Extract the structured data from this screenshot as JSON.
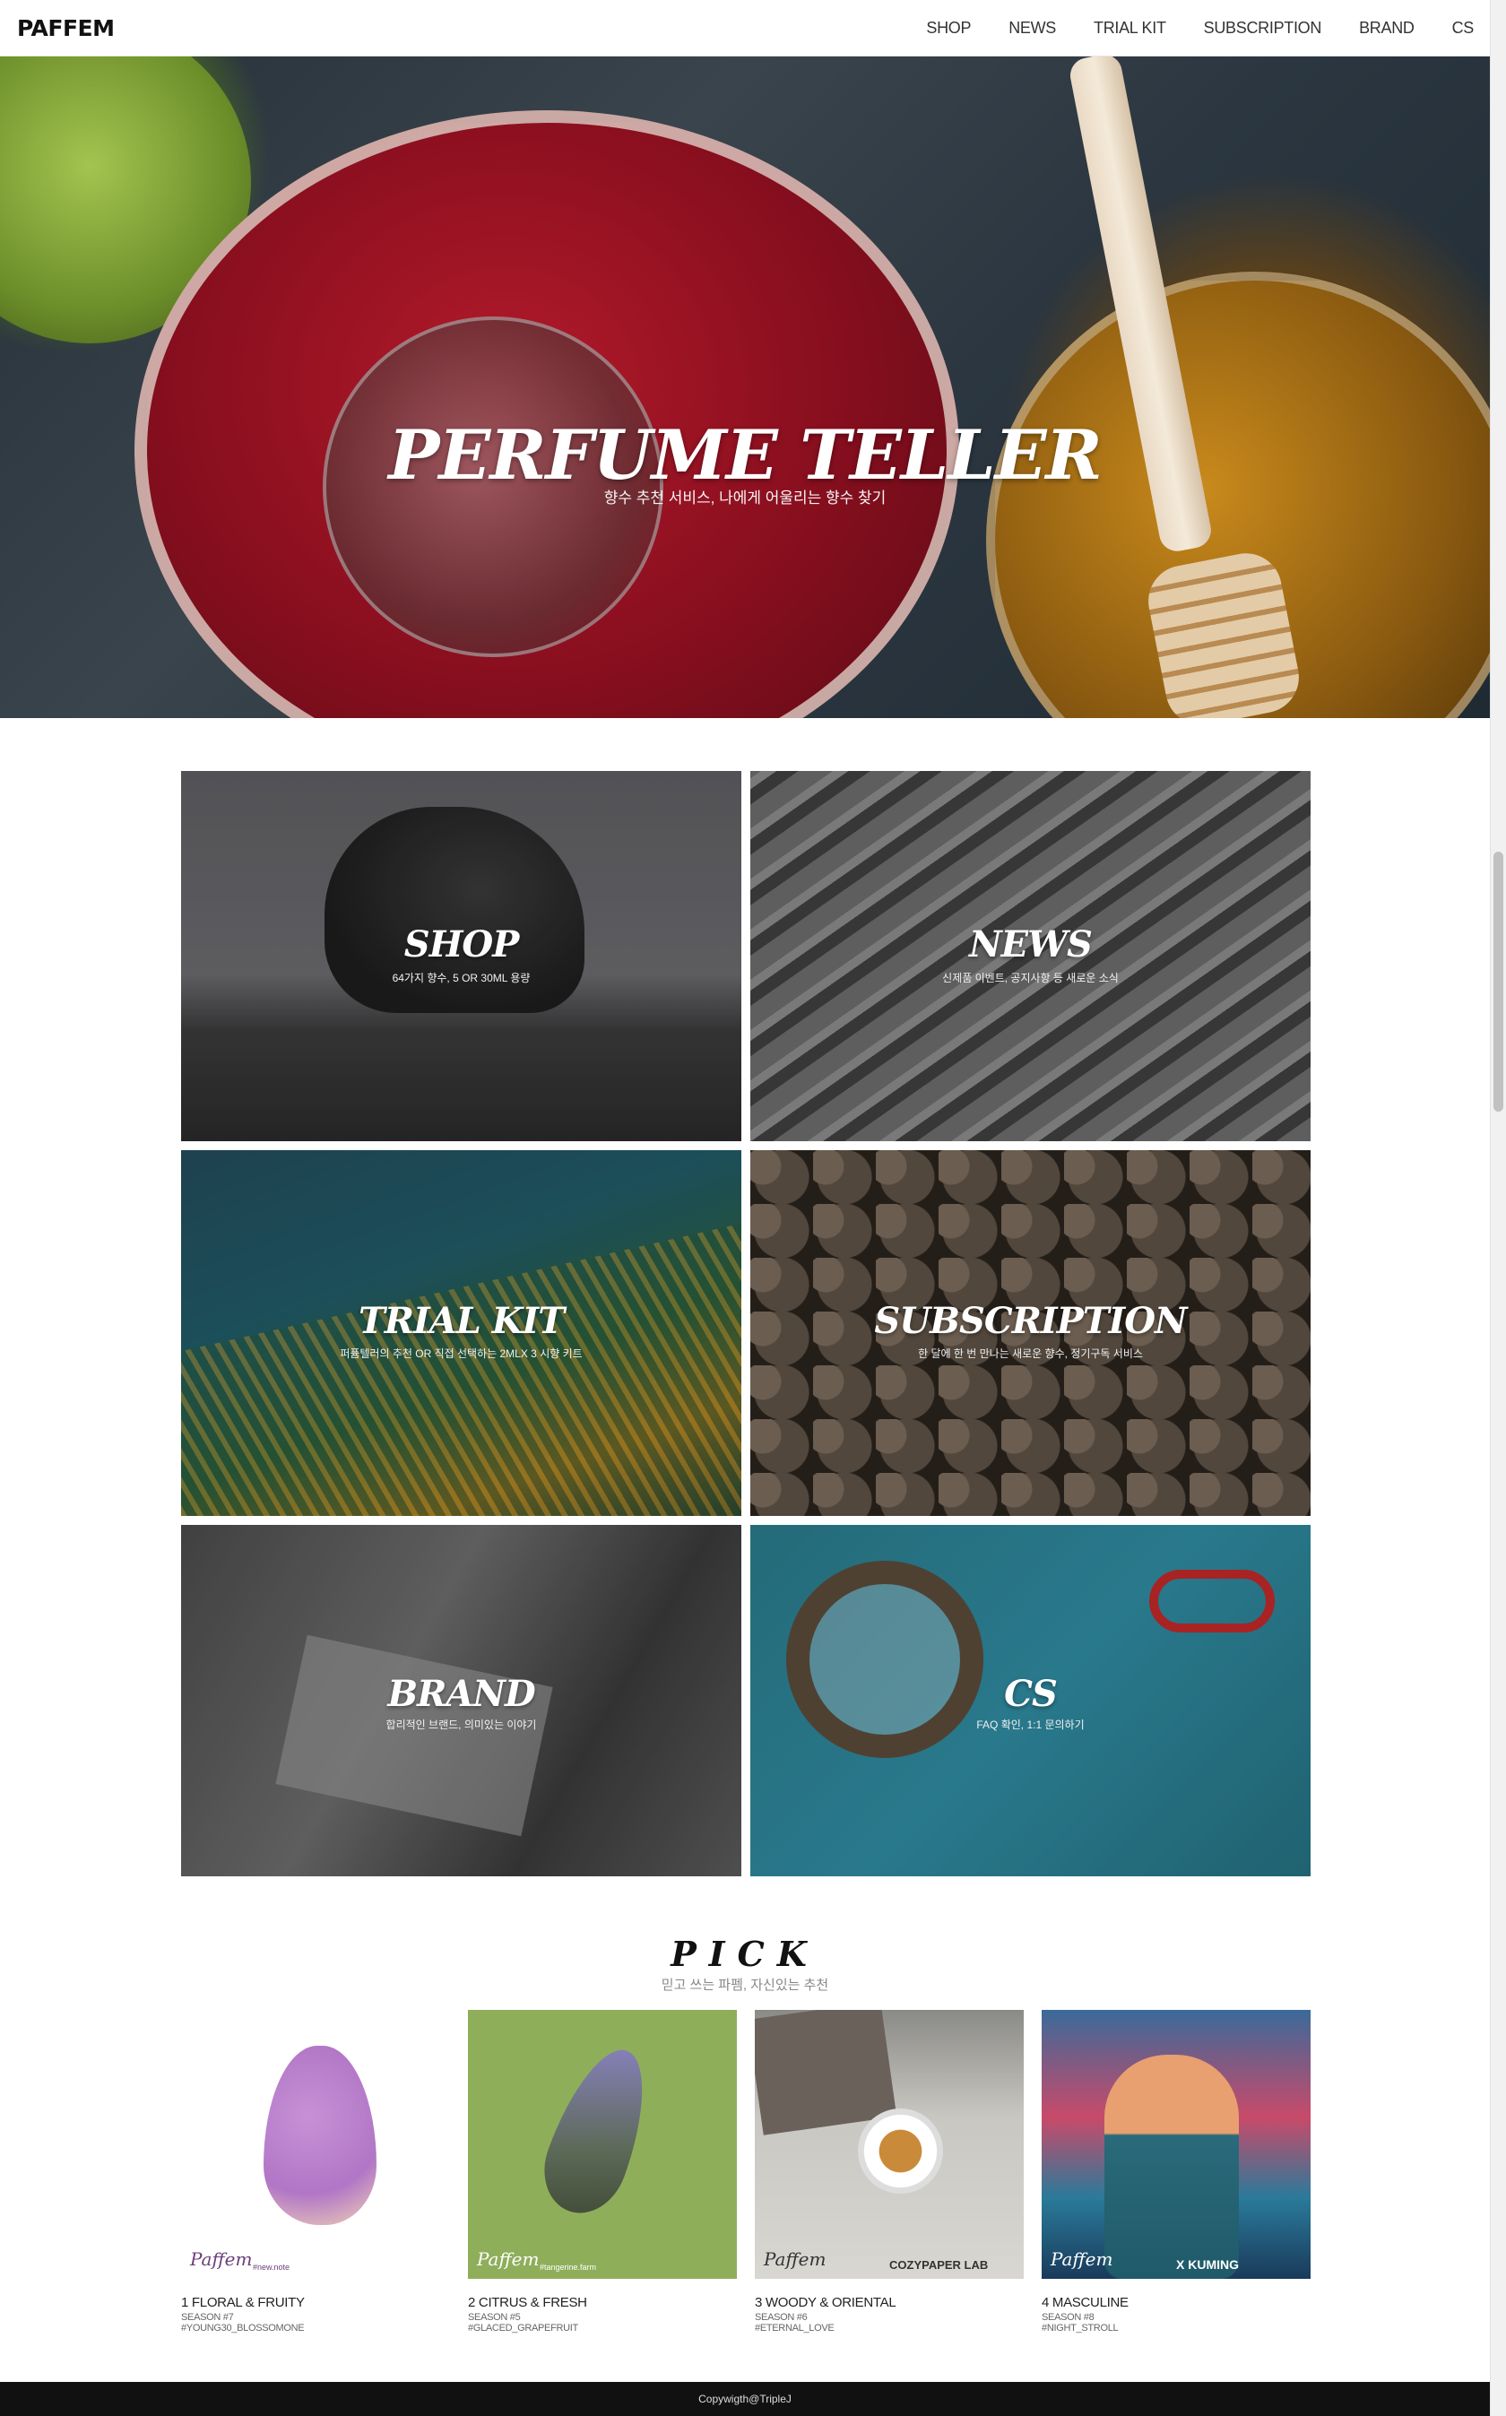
{
  "nav": {
    "logo": "PAFFEM",
    "items": [
      "SHOP",
      "NEWS",
      "TRIAL KIT",
      "SUBSCRIPTION",
      "BRAND",
      "CS"
    ]
  },
  "hero": {
    "title": "PERFUME TELLER",
    "subtitle": "향수 추천 서비스, 나에게 어울리는 향수 찾기"
  },
  "tiles": [
    {
      "title": "SHOP",
      "subtitle": "64가지 향수, 5 OR 30ML 용량"
    },
    {
      "title": "NEWS",
      "subtitle": "신제품 이벤트, 공지사항 등 새로운 소식"
    },
    {
      "title": "TRIAL KIT",
      "subtitle": "퍼퓸텔러의 추천 OR 직접 선택하는 2MLX 3 시향 키트"
    },
    {
      "title": "SUBSCRIPTION",
      "subtitle": "한 달에 한 번 만나는 새로운 향수, 정기구독 서비스"
    },
    {
      "title": "BRAND",
      "subtitle": "합리적인 브랜드, 의미있는 이야기"
    },
    {
      "title": "CS",
      "subtitle": "FAQ 확인, 1:1 문의하기"
    }
  ],
  "pick": {
    "title": "PICK",
    "subtitle": "믿고 쓰는 파펨, 자신있는 추천",
    "cards": [
      {
        "name": "1 FLORAL & FRUITY",
        "season": "SEASON #7",
        "tag": "#YOUNG30_BLOSSOMONE",
        "mark": "Paffem",
        "mark_sub": "#new.note"
      },
      {
        "name": "2 CITRUS & FRESH",
        "season": "SEASON #5",
        "tag": "#GLACED_GRAPEFRUIT",
        "mark": "Paffem",
        "mark_sub": "#tangerine.farm"
      },
      {
        "name": "3 WOODY & ORIENTAL",
        "season": "SEASON #6",
        "tag": "#ETERNAL_LOVE",
        "mark": "Paffem",
        "mark_sub": "COZYPAPER LAB"
      },
      {
        "name": "4 MASCULINE",
        "season": "SEASON #8",
        "tag": "#NIGHT_STROLL",
        "mark": "Paffem",
        "mark_sub": "X KUMING"
      }
    ]
  },
  "footer": {
    "text": "Copywigth@TripleJ"
  },
  "colors": {
    "accent": "#111111",
    "footer_bg": "#111111"
  }
}
